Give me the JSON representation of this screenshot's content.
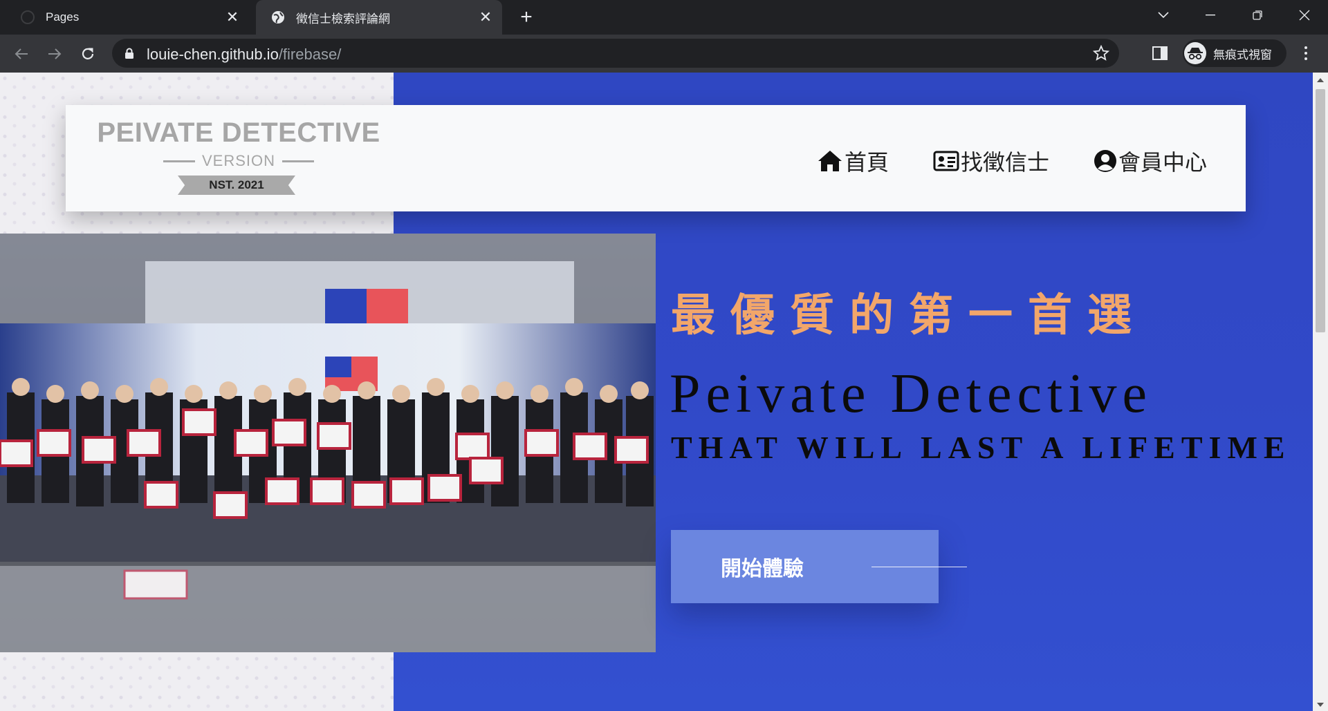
{
  "browser": {
    "tabs": [
      {
        "title": "Pages",
        "active": false
      },
      {
        "title": "徵信士檢索評論網",
        "active": true
      }
    ],
    "new_tab_icon": "plus-icon",
    "address": {
      "host": "louie-chen.github.io",
      "path": "/firebase/"
    },
    "incognito_label": "無痕式視窗"
  },
  "site": {
    "logo": {
      "main": "PEIVATE DETECTIVE",
      "version": "VERSION",
      "est": "NST. 2021"
    },
    "nav": [
      {
        "label": "首頁",
        "icon": "home-icon"
      },
      {
        "label": "找徵信士",
        "icon": "id-card-icon"
      },
      {
        "label": "會員中心",
        "icon": "user-circle-icon"
      }
    ],
    "hero": {
      "headline_zh": "最優質的第一首選",
      "headline_en": "Peivate Detective",
      "subline": "THAT WILL LAST A LIFETIME",
      "cta_label": "開始體驗"
    }
  },
  "colors": {
    "accent_orange": "#f2a66a",
    "hero_blue": "#3149c8",
    "cta_blue": "#6b86e0"
  }
}
